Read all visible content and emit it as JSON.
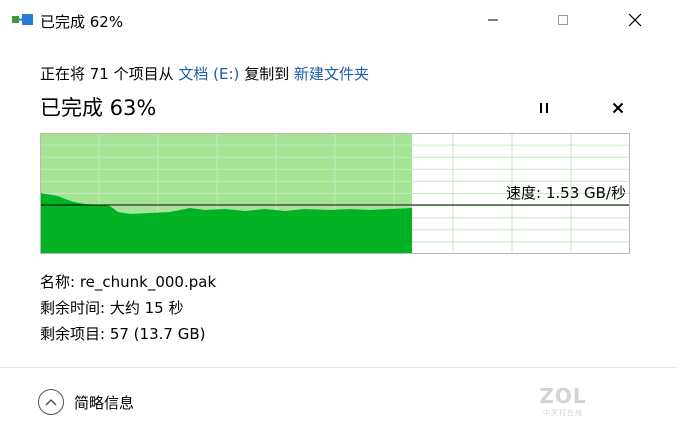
{
  "window": {
    "title": "已完成 62%",
    "minimize_icon": "minimize-icon",
    "maximize_icon": "maximize-icon",
    "close_icon": "close-icon"
  },
  "copy": {
    "line_prefix": "正在将 71 个项目从 ",
    "source": "文档 (E:)",
    "line_middle": " 复制到 ",
    "destination": "新建文件夹",
    "progress_text": "已完成 63%",
    "progress_fraction": 0.63,
    "pause_icon": "pause-icon",
    "cancel_icon": "cancel-icon"
  },
  "speed": {
    "label": "速度: 1.53 GB/秒"
  },
  "info": {
    "name": "名称: re_chunk_000.pak",
    "time_remaining": "剩余时间: 大约 15 秒",
    "items_remaining": "剩余项目: 57 (13.7 GB)"
  },
  "footer": {
    "details_label": "简略信息",
    "chevron_icon": "chevron-up-icon"
  },
  "watermark": {
    "logo": "ZOL",
    "sub": "中关村在线"
  },
  "colors": {
    "progress_fill": "#a5e495",
    "speed_fill": "#00b224",
    "grid": "#c5e8c0",
    "link": "#1f5da9"
  }
}
